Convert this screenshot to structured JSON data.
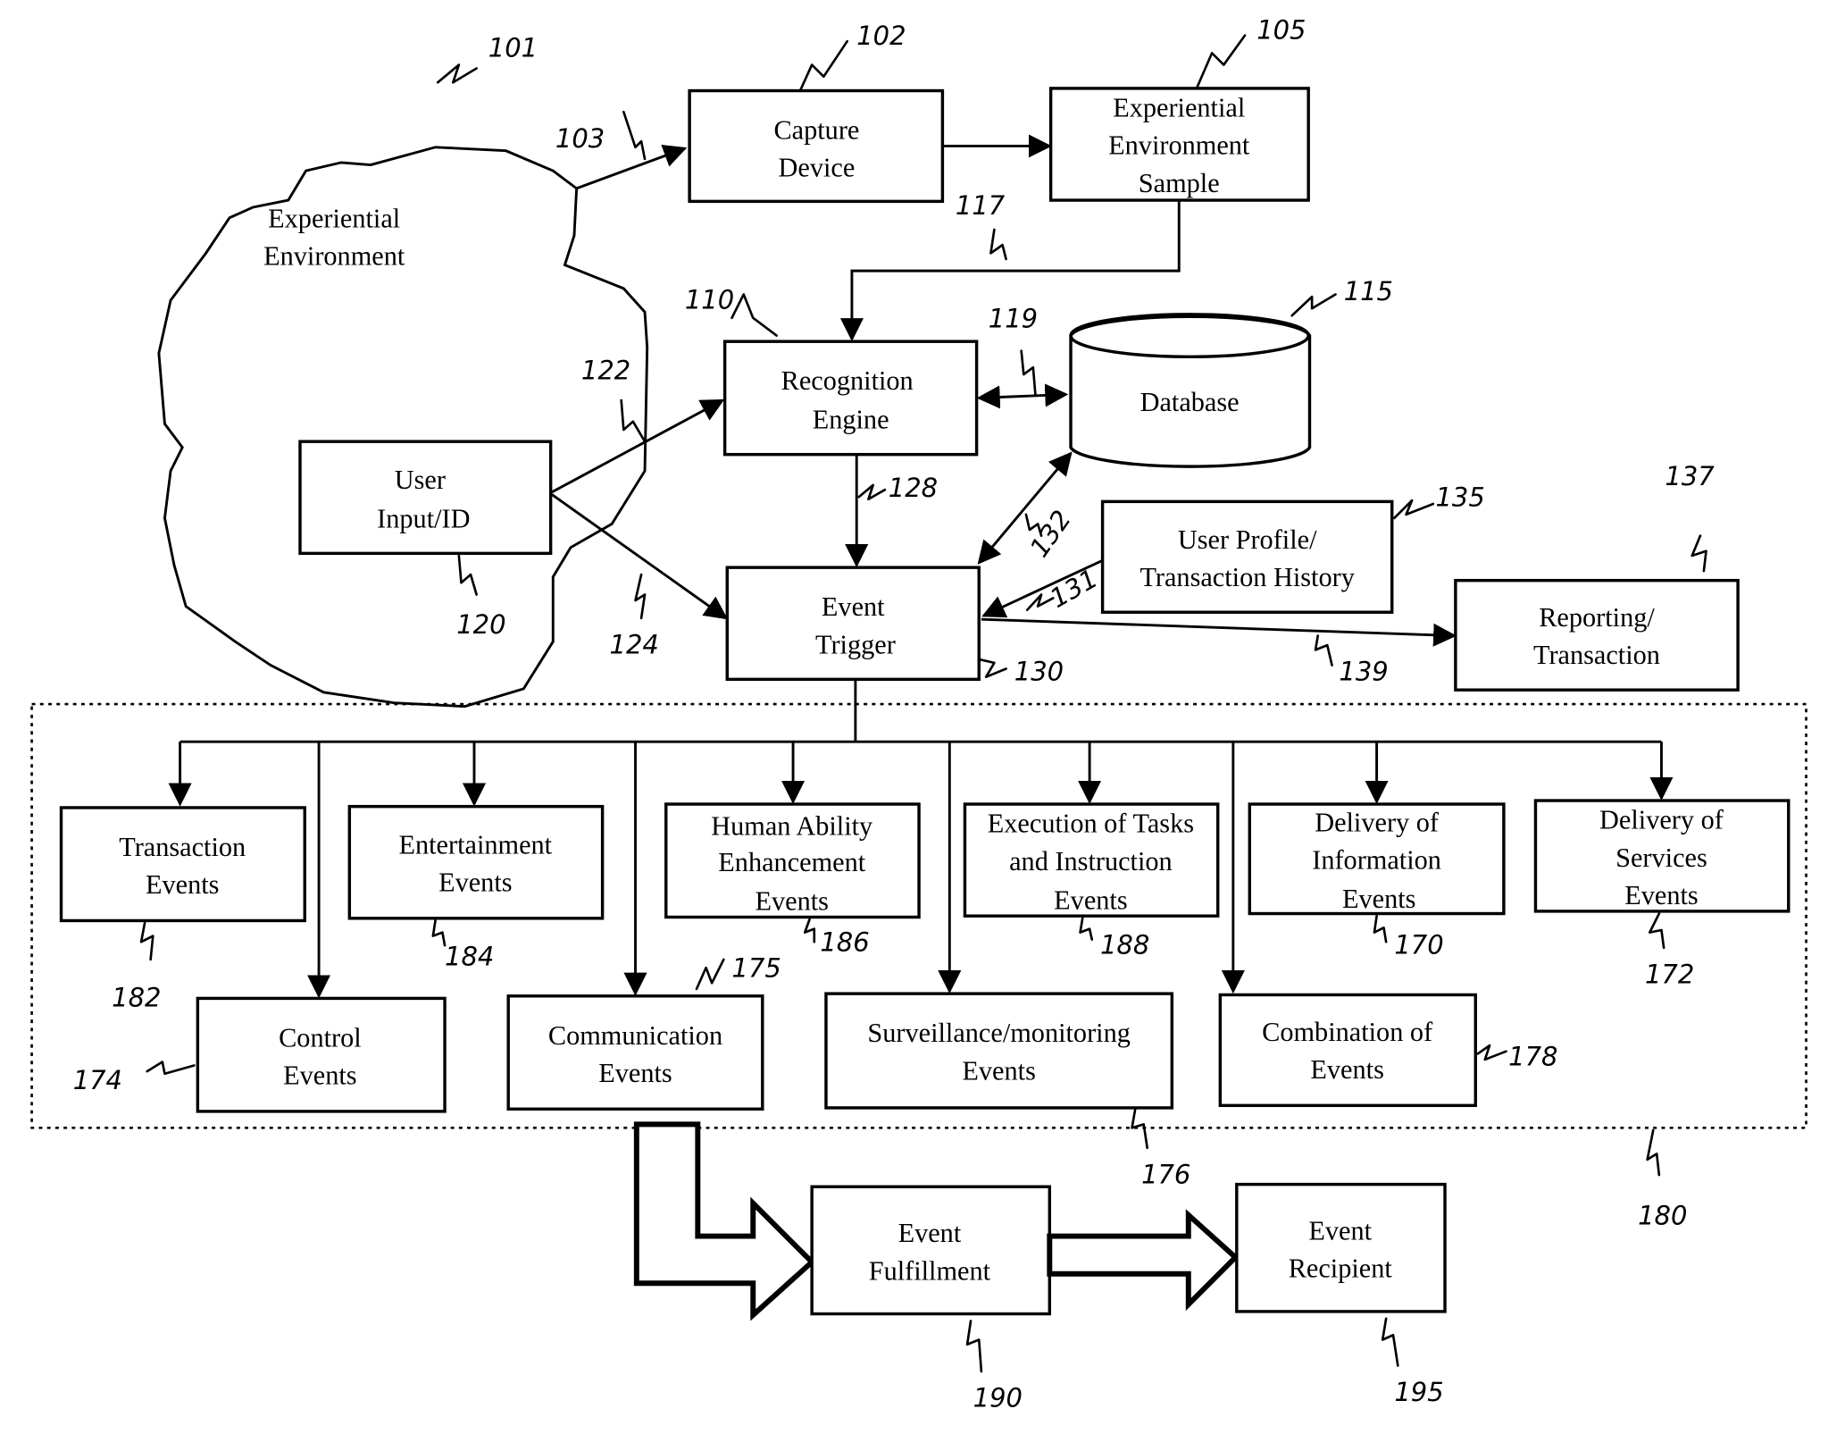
{
  "figure": {
    "nodes": {
      "experiential_environment": {
        "lines": [
          "Experiential",
          "Environment"
        ],
        "ref": "101"
      },
      "capture_device": {
        "lines": [
          "Capture",
          "Device"
        ],
        "ref": "102"
      },
      "environment_sample": {
        "lines": [
          "Experiential",
          "Environment",
          "Sample"
        ],
        "ref": "105"
      },
      "recognition_engine": {
        "lines": [
          "Recognition",
          "Engine"
        ],
        "ref": "110"
      },
      "database": {
        "lines": [
          "Database"
        ],
        "ref": "115"
      },
      "user_input": {
        "lines": [
          "User",
          "Input/ID"
        ],
        "ref": "120"
      },
      "event_trigger": {
        "lines": [
          "Event",
          "Trigger"
        ],
        "ref": "130"
      },
      "user_profile": {
        "lines": [
          "User Profile/",
          "Transaction History"
        ],
        "ref": "135"
      },
      "reporting": {
        "lines": [
          "Reporting/",
          "Transaction"
        ],
        "ref": "137"
      },
      "transaction_events": {
        "lines": [
          "Transaction",
          "Events"
        ],
        "ref": "182"
      },
      "entertainment_events": {
        "lines": [
          "Entertainment",
          "Events"
        ],
        "ref": "184"
      },
      "human_ability_events": {
        "lines": [
          "Human Ability",
          "Enhancement",
          "Events"
        ],
        "ref": "186"
      },
      "execution_events": {
        "lines": [
          "Execution of Tasks",
          "and Instruction",
          "Events"
        ],
        "ref": "188"
      },
      "information_events": {
        "lines": [
          "Delivery of",
          "Information",
          "Events"
        ],
        "ref": "170"
      },
      "services_events": {
        "lines": [
          "Delivery of",
          "Services",
          "Events"
        ],
        "ref": "172"
      },
      "control_events": {
        "lines": [
          "Control",
          "Events"
        ],
        "ref": "174"
      },
      "communication_events": {
        "lines": [
          "Communication",
          "Events"
        ],
        "ref": "175"
      },
      "surveillance_events": {
        "lines": [
          "Surveillance/monitoring",
          "Events"
        ],
        "ref": "176"
      },
      "combination_events": {
        "lines": [
          "Combination of",
          "Events"
        ],
        "ref": "178"
      },
      "event_fulfillment": {
        "lines": [
          "Event",
          "Fulfillment"
        ],
        "ref": "190"
      },
      "event_recipient": {
        "lines": [
          "Event",
          "Recipient"
        ],
        "ref": "195"
      }
    },
    "connector_refs": {
      "env_to_capture": "103",
      "sample_to_recognition": "117",
      "recognition_database": "119",
      "user_to_recognition": "122",
      "user_to_trigger": "124",
      "recognition_to_trigger": "128",
      "profile_to_trigger": "131",
      "trigger_database": "132",
      "trigger_to_reporting": "139",
      "event_group": "180"
    }
  }
}
